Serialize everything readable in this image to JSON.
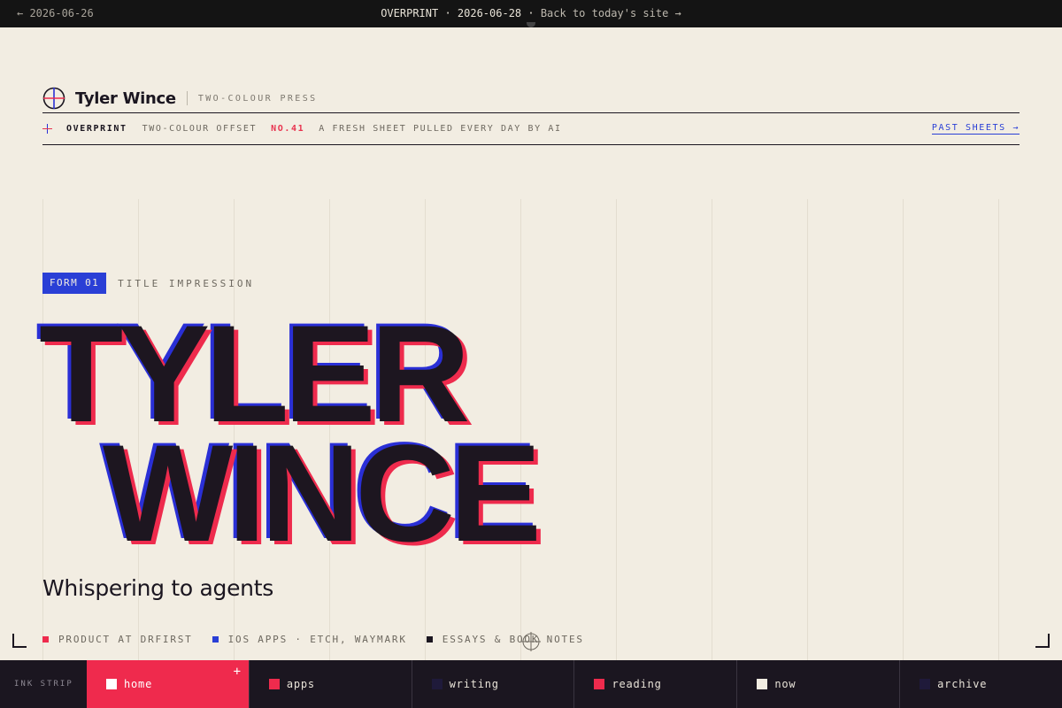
{
  "topbar": {
    "prev": "← 2026-06-26",
    "edition": "OVERPRINT · 2026-06-28 ·",
    "back": "Back to today's site →"
  },
  "brand": {
    "name": "Tyler Wince",
    "tagline": "TWO-COLOUR PRESS",
    "icon": "registration-mark-icon"
  },
  "ribbon": {
    "name": "OVERPRINT",
    "process": "TWO-COLOUR OFFSET",
    "number": "NO.41",
    "description": "A FRESH SHEET PULLED EVERY DAY BY AI",
    "past_link": "PAST SHEETS →"
  },
  "form": {
    "badge": "FORM 01",
    "title": "TITLE IMPRESSION"
  },
  "hero": {
    "line1": "TYLER",
    "line2": "WINCE"
  },
  "subtitle": "Whispering to agents",
  "tags": [
    {
      "label": "PRODUCT AT DRFIRST",
      "color": "#ee2b4d"
    },
    {
      "label": "IOS APPS · ETCH, WAYMARK",
      "color": "#2a3fd6"
    },
    {
      "label": "ESSAYS & BOOK NOTES",
      "color": "#1b1620"
    }
  ],
  "strip": {
    "label": "INK STRIP",
    "tabs": [
      {
        "label": "home",
        "swatch": "#ffffff",
        "active": true
      },
      {
        "label": "apps",
        "swatch": "#ee2b4d",
        "active": false
      },
      {
        "label": "writing",
        "swatch": "#1f1a3a",
        "active": false
      },
      {
        "label": "reading",
        "swatch": "#ee2b4d",
        "active": false
      },
      {
        "label": "now",
        "swatch": "#f2ede2",
        "active": false
      },
      {
        "label": "archive",
        "swatch": "#1f1a3a",
        "active": false
      }
    ]
  },
  "colors": {
    "paper": "#f2ede2",
    "ink_black": "#1b1620",
    "ink_blue": "#2a3fd6",
    "ink_red": "#ee2b4d"
  }
}
